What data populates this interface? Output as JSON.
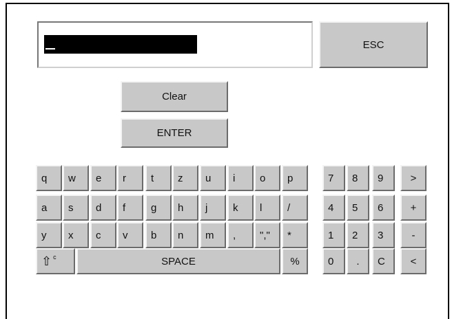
{
  "input": {
    "value": ""
  },
  "buttons": {
    "esc": "ESC",
    "clear": "Clear",
    "enter": "ENTER"
  },
  "keys": {
    "row1": [
      "q",
      "w",
      "e",
      "r",
      "t",
      "z",
      "u",
      "i",
      "o",
      "p"
    ],
    "row2": [
      "a",
      "s",
      "d",
      "f",
      "g",
      "h",
      "j",
      "k",
      "l",
      "/"
    ],
    "row3": [
      "y",
      "x",
      "c",
      "v",
      "b",
      "n",
      "m",
      ",",
      "\",\"",
      "*"
    ],
    "space": "SPACE",
    "percent": "%",
    "shift_glyph": "⇧",
    "shift_sup": "c",
    "numpad": [
      [
        "7",
        "8",
        "9",
        ">"
      ],
      [
        "4",
        "5",
        "6",
        "+"
      ],
      [
        "1",
        "2",
        "3",
        "-"
      ],
      [
        "0",
        ".",
        "C",
        "<"
      ]
    ]
  }
}
